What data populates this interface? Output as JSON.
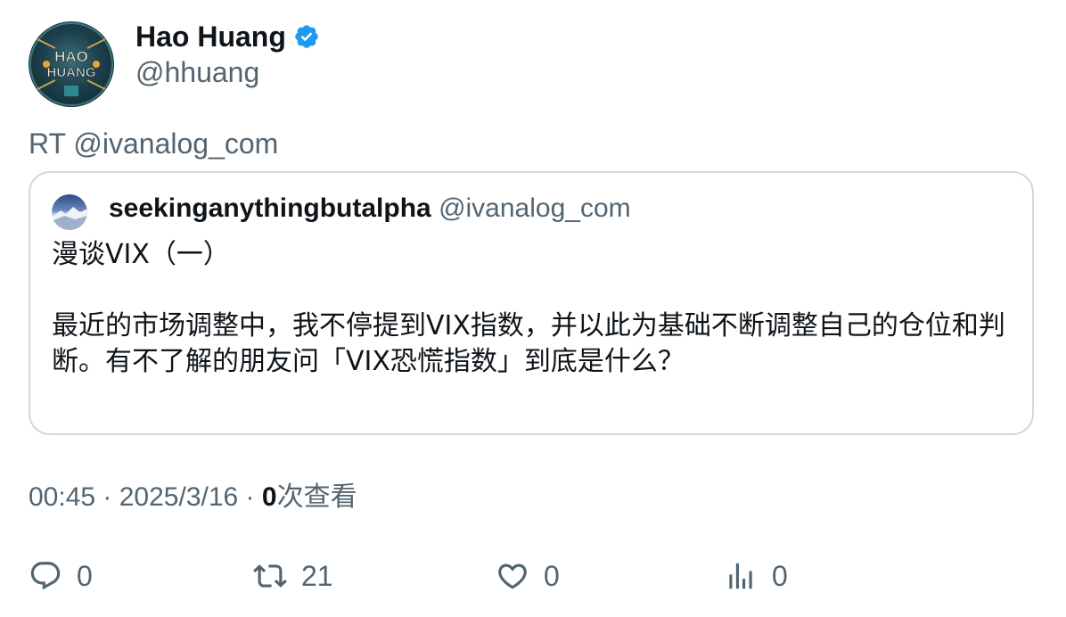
{
  "author": {
    "name": "Hao Huang",
    "handle": "@hhuang",
    "avatar_text": [
      "HAO",
      "HUANG"
    ],
    "verified_icon": "verified-badge-icon",
    "verified_color": "#1d9bf0"
  },
  "retweet_line": "RT @ivanalog_com",
  "quoted": {
    "name": "seekinganythingbutalpha",
    "handle": "@ivanalog_com",
    "title": "漫谈VIX（一）",
    "body": "最近的市场调整中，我不停提到VIX指数，并以此为基础不断调整自己的仓位和判断。有不了解的朋友问「VIX恐慌指数」到底是什么？"
  },
  "meta": {
    "time": "00:45",
    "separator": " · ",
    "date": "2025/3/16",
    "views_count": "0",
    "views_label": "次查看"
  },
  "actions": {
    "reply": {
      "icon": "reply-icon",
      "count": "0"
    },
    "retweet": {
      "icon": "retweet-icon",
      "count": "21"
    },
    "like": {
      "icon": "heart-icon",
      "count": "0"
    },
    "views": {
      "icon": "views-chart-icon",
      "count": "0"
    }
  },
  "colors": {
    "text": "#0f1419",
    "secondary": "#536471",
    "border": "#cfd9de"
  }
}
